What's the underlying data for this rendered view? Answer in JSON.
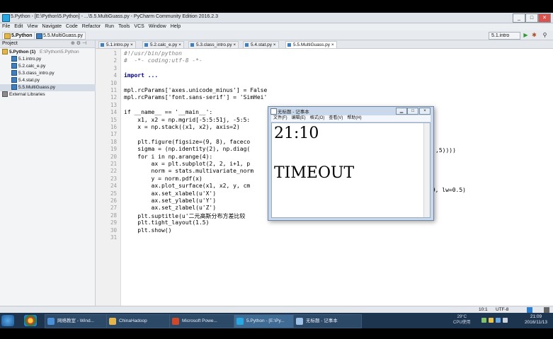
{
  "window": {
    "title": "5.Python - [E:\\Python\\5.Python] - ...\\5.5.MultiGuass.py - PyCharm Community Edition 2016.2.3",
    "min_label": "_",
    "max_label": "□",
    "close_label": "✕"
  },
  "menu": [
    "File",
    "Edit",
    "View",
    "Navigate",
    "Code",
    "Refactor",
    "Run",
    "Tools",
    "VCS",
    "Window",
    "Help"
  ],
  "nav": {
    "crumbs": [
      "5.Python",
      "5.5.MultiGuass.py"
    ],
    "run_config": "5.1.intro",
    "run_icon": "▶",
    "debug_icon": "✱",
    "search_icon": "⚲"
  },
  "project": {
    "header": "Project",
    "root": "5.Python (1)",
    "root_path": "E:\\Python\\5.Python",
    "files": [
      "5.1.intro.py",
      "5.2.calc_e.py",
      "5.3.class_intro.py",
      "5.4.stat.py",
      "5.5.MultiGuass.py"
    ],
    "selected_file_index": 4,
    "external": "External Libraries"
  },
  "tabs": [
    "5.1.intro.py",
    "5.2.calc_e.py",
    "5.3.class_intro.py",
    "5.4.stat.py",
    "5.5.MultiGuass.py"
  ],
  "active_tab_index": 4,
  "code_lines": [
    {
      "n": "1",
      "text": "#!/usr/bin/python",
      "cls": "cm"
    },
    {
      "n": "2",
      "text": "#  -*- coding:utf-8 -*-",
      "cls": "cm"
    },
    {
      "n": "3",
      "text": "",
      "cls": ""
    },
    {
      "n": "4",
      "text": "import ...",
      "cls": "kw"
    },
    {
      "n": "10",
      "text": "",
      "cls": ""
    },
    {
      "n": "11",
      "text": "mpl.rcParams['axes.unicode_minus'] = False",
      "cls": ""
    },
    {
      "n": "12",
      "text": "mpl.rcParams['font.sans-serif'] = 'SimHei'",
      "cls": ""
    },
    {
      "n": "13",
      "text": "",
      "cls": ""
    },
    {
      "n": "14",
      "text": "if __name__ == '__main__':",
      "cls": ""
    },
    {
      "n": "15",
      "text": "    x1, x2 = np.mgrid[-5:5:51j, -5:5:",
      "cls": ""
    },
    {
      "n": "16",
      "text": "    x = np.stack((x1, x2), axis=2)",
      "cls": ""
    },
    {
      "n": "17",
      "text": "",
      "cls": ""
    },
    {
      "n": "18",
      "text": "    plt.figure(figsize=(9, 8), faceco",
      "cls": ""
    },
    {
      "n": "19",
      "text": "    sigma = (np.identity(2), np.diag(",
      "cls": ""
    },
    {
      "n": "20",
      "text": "    for i in np.arange(4):",
      "cls": ""
    },
    {
      "n": "21",
      "text": "        ax = plt.subplot(2, 2, i+1, p",
      "cls": ""
    },
    {
      "n": "22",
      "text": "        norm = stats.multivariate_norm",
      "cls": ""
    },
    {
      "n": "23",
      "text": "        y = norm.pdf(x)",
      "cls": ""
    },
    {
      "n": "24",
      "text": "        ax.plot_surface(x1, x2, y, cm",
      "cls": ""
    },
    {
      "n": "25",
      "text": "        ax.set_xlabel(u'X')",
      "cls": ""
    },
    {
      "n": "26",
      "text": "        ax.set_ylabel(u'Y')",
      "cls": ""
    },
    {
      "n": "27",
      "text": "        ax.set_zlabel(u'Z')",
      "cls": ""
    },
    {
      "n": "28",
      "text": "    plt.suptitle(u'二元高斯分布方差比较",
      "cls": ""
    },
    {
      "n": "29",
      "text": "    plt.tight_layout(1.5)",
      "cls": ""
    },
    {
      "n": "30",
      "text": "    plt.show()",
      "cls": ""
    },
    {
      "n": "31",
      "text": "",
      "cls": ""
    }
  ],
  "overflow": {
    "line19_tail": ",5))))",
    "line24_tail": ".9, lw=0.5)"
  },
  "notepad": {
    "title": "无标题 - 记事本",
    "menu": [
      "文件(F)",
      "编辑(E)",
      "格式(O)",
      "查看(V)",
      "帮助(H)"
    ],
    "line1": "21:10",
    "line2": "TIMEOUT"
  },
  "status": {
    "position": "10:1",
    "encoding": "UTF-8"
  },
  "taskbar": {
    "tasks": [
      "网络教室 - Wind...",
      "ChinaHadoop",
      "Microsoft Powe...",
      "5.Python - [E:\\Py...",
      "无标题 - 记事本"
    ],
    "clock_time": "21:09",
    "clock_date": "2016/11/13",
    "cpu_label": "CPU使用"
  },
  "colors": {
    "accent": "#27a8e0",
    "taskbar": "#1e3550",
    "string": "#008000",
    "keyword": "#000080"
  }
}
